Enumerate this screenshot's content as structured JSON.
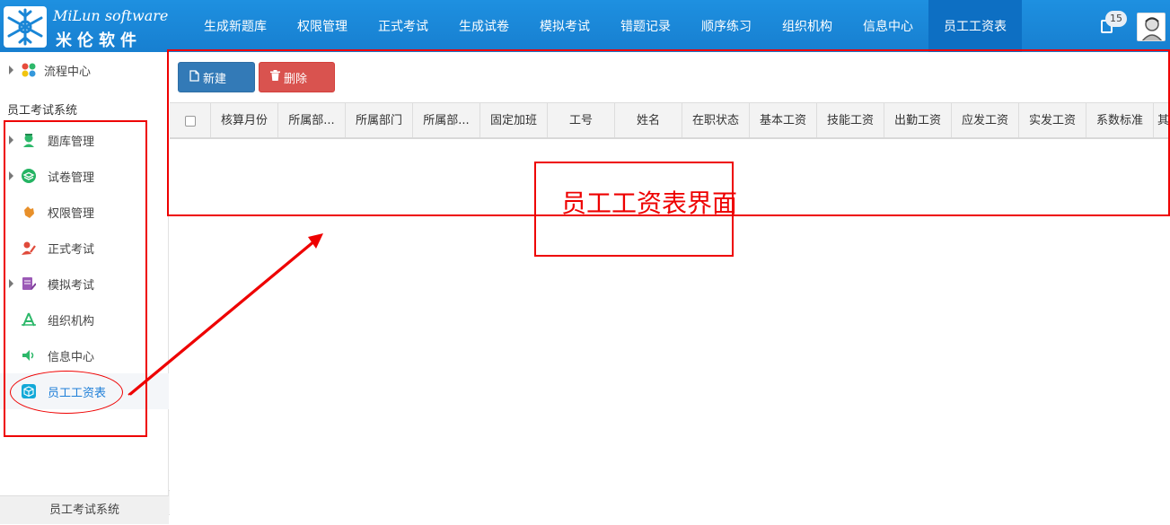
{
  "logo": {
    "text_en": "MiLun software",
    "text_cn": "米伦软件"
  },
  "topnav": {
    "items": [
      {
        "label": "生成新题库"
      },
      {
        "label": "权限管理"
      },
      {
        "label": "正式考试"
      },
      {
        "label": "生成试卷"
      },
      {
        "label": "模拟考试"
      },
      {
        "label": "错题记录"
      },
      {
        "label": "顺序练习"
      },
      {
        "label": "组织机构"
      },
      {
        "label": "信息中心"
      },
      {
        "label": "员工工资表"
      }
    ],
    "active_index": 9,
    "notification_count": "15"
  },
  "sidebar": {
    "flow_item": "流程中心",
    "section_title": "员工考试系统",
    "items": [
      {
        "label": "题库管理",
        "icon": "graduate-icon",
        "color": "#2db86a",
        "expandable": true
      },
      {
        "label": "试卷管理",
        "icon": "layers-icon",
        "color": "#25b463",
        "expandable": true
      },
      {
        "label": "权限管理",
        "icon": "hand-icon",
        "color": "#e8902a",
        "expandable": false
      },
      {
        "label": "正式考试",
        "icon": "user-edit-icon",
        "color": "#e04a3a",
        "expandable": false
      },
      {
        "label": "模拟考试",
        "icon": "document-edit-icon",
        "color": "#9b59b6",
        "expandable": true
      },
      {
        "label": "组织机构",
        "icon": "org-icon",
        "color": "#2db86a",
        "expandable": false
      },
      {
        "label": "信息中心",
        "icon": "speaker-icon",
        "color": "#2db86a",
        "expandable": false
      },
      {
        "label": "员工工资表",
        "icon": "cube-icon",
        "color": "#12a9d8",
        "expandable": false
      }
    ],
    "active_index": 7,
    "footer": "员工考试系统"
  },
  "toolbar": {
    "new_label": "新建",
    "delete_label": "删除"
  },
  "grid": {
    "columns": [
      "核算月份",
      "所属部...",
      "所属部门",
      "所属部...",
      "固定加班",
      "工号",
      "姓名",
      "在职状态",
      "基本工资",
      "技能工资",
      "出勤工资",
      "应发工资",
      "实发工资",
      "系数标准",
      "其"
    ]
  },
  "annotation": {
    "label": "员工工资表界面",
    "color": "#e00000"
  },
  "colors": {
    "nav_bg": "#1e90e0",
    "nav_active": "#0d6fc3",
    "primary": "#337ab7",
    "danger": "#d9534f"
  }
}
